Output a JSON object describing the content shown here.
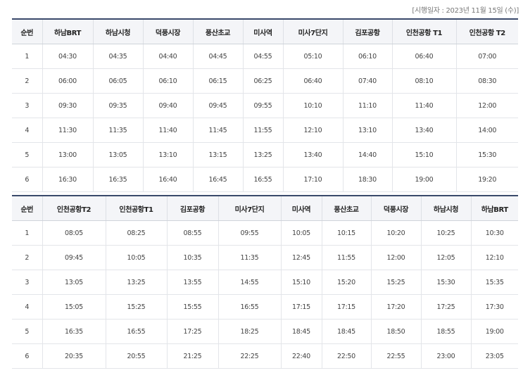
{
  "effective_date": "[시행일자 : 2023년 11월 15일 (수)]",
  "table_a": {
    "headers": [
      "순번",
      "하남BRT",
      "하남시청",
      "덕풍시장",
      "풍산초교",
      "미사역",
      "미사7단지",
      "김포공항",
      "인천공항 T1",
      "인천공항 T2"
    ],
    "rows": [
      [
        "1",
        "04:30",
        "04:35",
        "04:40",
        "04:45",
        "04:55",
        "05:10",
        "06:10",
        "06:40",
        "07:00"
      ],
      [
        "2",
        "06:00",
        "06:05",
        "06:10",
        "06:15",
        "06:25",
        "06:40",
        "07:40",
        "08:10",
        "08:30"
      ],
      [
        "3",
        "09:30",
        "09:35",
        "09:40",
        "09:45",
        "09:55",
        "10:10",
        "11:10",
        "11:40",
        "12:00"
      ],
      [
        "4",
        "11:30",
        "11:35",
        "11:40",
        "11:45",
        "11:55",
        "12:10",
        "13:10",
        "13:40",
        "14:00"
      ],
      [
        "5",
        "13:00",
        "13:05",
        "13:10",
        "13:15",
        "13:25",
        "13:40",
        "14:40",
        "15:10",
        "15:30"
      ],
      [
        "6",
        "16:30",
        "16:35",
        "16:40",
        "16:45",
        "16:55",
        "17:10",
        "18:30",
        "19:00",
        "19:20"
      ]
    ]
  },
  "table_b": {
    "headers": [
      "순번",
      "인천공항T2",
      "인천공항T1",
      "김포공항",
      "미사7단지",
      "미사역",
      "풍산초교",
      "덕풍시장",
      "하남시청",
      "하남BRT"
    ],
    "rows": [
      [
        "1",
        "08:05",
        "08:25",
        "08:55",
        "09:55",
        "10:05",
        "10:15",
        "10:20",
        "10:25",
        "10:30"
      ],
      [
        "2",
        "09:45",
        "10:05",
        "10:35",
        "11:35",
        "12:45",
        "11:55",
        "12:00",
        "12:05",
        "12:10"
      ],
      [
        "3",
        "13:05",
        "13:25",
        "13:55",
        "14:55",
        "15:10",
        "15:20",
        "15:25",
        "15:30",
        "15:35"
      ],
      [
        "4",
        "15:05",
        "15:25",
        "15:55",
        "16:55",
        "17:15",
        "17:15",
        "17:20",
        "17:25",
        "17:30"
      ],
      [
        "5",
        "16:35",
        "16:55",
        "17:25",
        "18:25",
        "18:45",
        "18:45",
        "18:50",
        "18:55",
        "19:00"
      ],
      [
        "6",
        "20:35",
        "20:55",
        "21:25",
        "22:25",
        "22:40",
        "22:50",
        "22:55",
        "23:00",
        "23:05"
      ]
    ]
  }
}
